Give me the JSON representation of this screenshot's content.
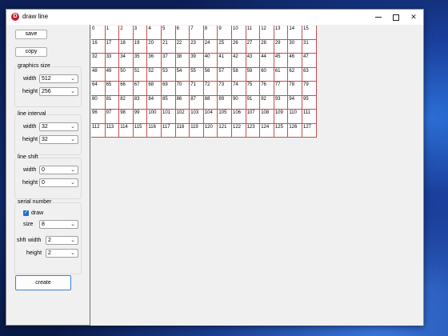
{
  "window": {
    "title": "draw line",
    "app_icon_letter": "D"
  },
  "toolbar": {
    "save_label": "save",
    "copy_label": "copy",
    "create_label": "create"
  },
  "graphics_size": {
    "title": "graphics size",
    "width_label": "width",
    "width_value": "512",
    "height_label": "height",
    "height_value": "256"
  },
  "line_interval": {
    "title": "line interval",
    "width_label": "width",
    "width_value": "32",
    "height_label": "height",
    "height_value": "32"
  },
  "line_shift": {
    "title": "line shift",
    "width_label": "width",
    "width_value": "0",
    "height_label": "height",
    "height_value": "0"
  },
  "serial_number": {
    "title": "serial number",
    "draw_label": "draw",
    "draw_checked": true,
    "size_label": "size",
    "size_value": "8",
    "shift_label": "shft",
    "shift_width_label": "width",
    "shift_width_value": "2",
    "shift_height_label": "height",
    "shift_height_value": "2"
  },
  "grid": {
    "columns": 16,
    "rows": 8,
    "line_color": "#c0504d",
    "cells": [
      "0",
      "1",
      "2",
      "3",
      "4",
      "5",
      "6",
      "7",
      "8",
      "9",
      "10",
      "11",
      "12",
      "13",
      "14",
      "15",
      "16",
      "17",
      "18",
      "19",
      "20",
      "21",
      "22",
      "23",
      "24",
      "25",
      "26",
      "27",
      "28",
      "29",
      "30",
      "31",
      "32",
      "33",
      "34",
      "35",
      "36",
      "37",
      "38",
      "39",
      "40",
      "41",
      "42",
      "43",
      "44",
      "45",
      "46",
      "47",
      "48",
      "49",
      "50",
      "51",
      "52",
      "53",
      "54",
      "55",
      "56",
      "57",
      "58",
      "59",
      "60",
      "61",
      "62",
      "63",
      "64",
      "65",
      "66",
      "67",
      "68",
      "69",
      "70",
      "71",
      "72",
      "73",
      "74",
      "75",
      "76",
      "77",
      "78",
      "79",
      "80",
      "81",
      "82",
      "83",
      "84",
      "85",
      "86",
      "87",
      "88",
      "89",
      "90",
      "91",
      "92",
      "93",
      "94",
      "95",
      "96",
      "97",
      "98",
      "99",
      "100",
      "101",
      "102",
      "103",
      "104",
      "105",
      "106",
      "107",
      "108",
      "109",
      "110",
      "111",
      "112",
      "113",
      "114",
      "115",
      "116",
      "117",
      "118",
      "119",
      "120",
      "121",
      "122",
      "123",
      "124",
      "125",
      "126",
      "127"
    ]
  }
}
